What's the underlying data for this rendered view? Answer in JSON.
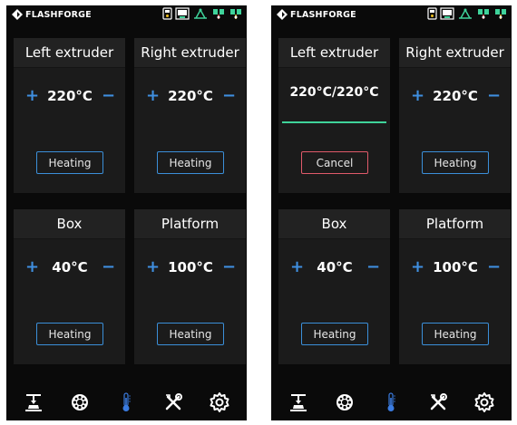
{
  "brand": {
    "name": "FLASHFORGE"
  },
  "status_icons": [
    "usb-icon",
    "camera-icon",
    "printer-status-icon",
    "left-extruder-status-icon",
    "right-extruder-status-icon"
  ],
  "colors": {
    "accent_blue": "#3b8fd9",
    "cancel_red": "#e05a6a",
    "progress_green": "#3fd39a",
    "thermometer_blue": "#3a7be0"
  },
  "nav": {
    "items": [
      {
        "name": "print",
        "icon": "print-icon"
      },
      {
        "name": "filament",
        "icon": "filament-icon"
      },
      {
        "name": "temperature",
        "icon": "thermometer-icon",
        "active": true
      },
      {
        "name": "tools",
        "icon": "tools-icon"
      },
      {
        "name": "settings",
        "icon": "gear-icon"
      }
    ]
  },
  "screens": [
    {
      "cards": {
        "left_extruder": {
          "title": "Left extruder",
          "temp": "220°C",
          "button": "Heating"
        },
        "right_extruder": {
          "title": "Right extruder",
          "temp": "220°C",
          "button": "Heating"
        },
        "box": {
          "title": "Box",
          "temp": "40°C",
          "button": "Heating"
        },
        "platform": {
          "title": "Platform",
          "temp": "100°C",
          "button": "Heating"
        }
      }
    },
    {
      "cards": {
        "left_extruder": {
          "title": "Left extruder",
          "temp": "220°C/220°C",
          "button": "Cancel",
          "heating_progress": 1.0
        },
        "right_extruder": {
          "title": "Right extruder",
          "temp": "220°C",
          "button": "Heating"
        },
        "box": {
          "title": "Box",
          "temp": "40°C",
          "button": "Heating"
        },
        "platform": {
          "title": "Platform",
          "temp": "100°C",
          "button": "Heating"
        }
      }
    }
  ],
  "controls": {
    "plus": "+",
    "minus": "−"
  }
}
